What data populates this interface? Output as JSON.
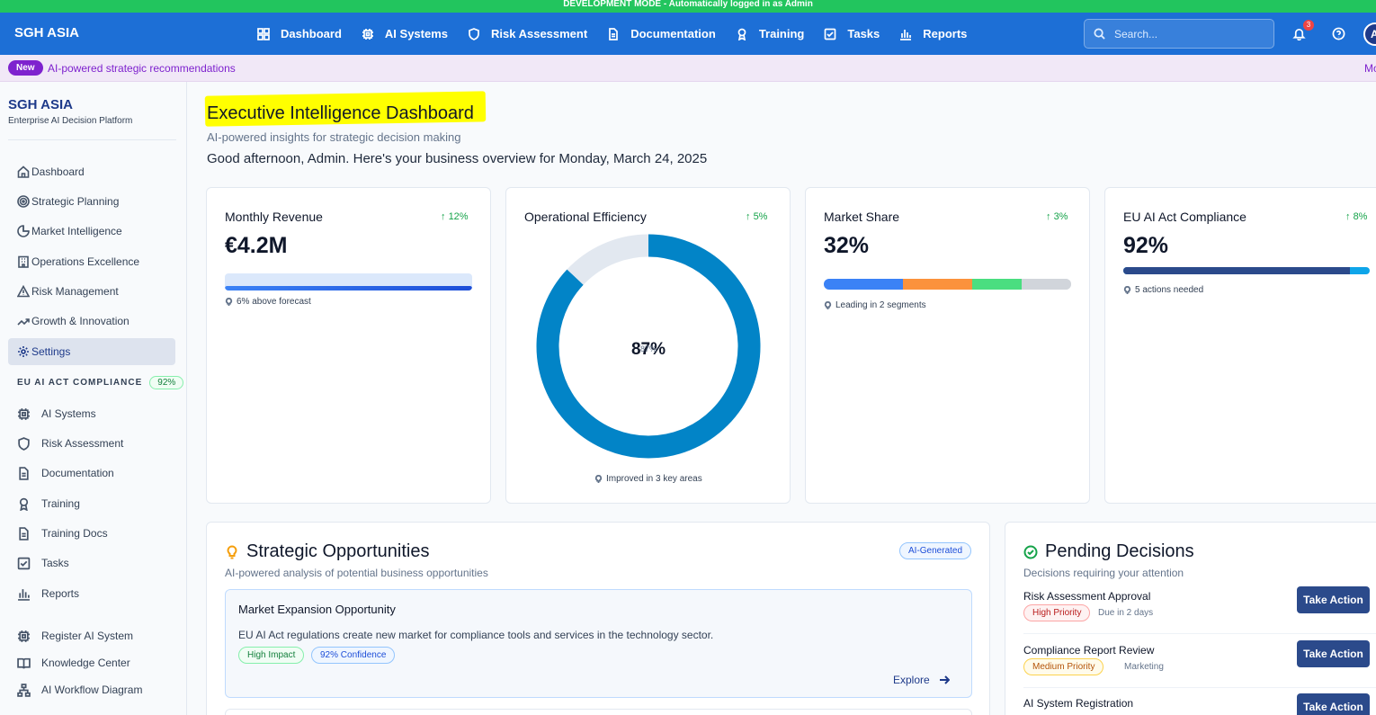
{
  "dev_banner": "DEVELOPMENT MODE - Automatically logged in as Admin",
  "topnav": {
    "brand": "SGH ASIA",
    "links": [
      {
        "label": "Dashboard",
        "icon": "grid-icon"
      },
      {
        "label": "AI Systems",
        "icon": "cpu-icon"
      },
      {
        "label": "Risk Assessment",
        "icon": "shield-icon"
      },
      {
        "label": "Documentation",
        "icon": "file-icon"
      },
      {
        "label": "Training",
        "icon": "award-icon"
      },
      {
        "label": "Tasks",
        "icon": "check-square-icon"
      },
      {
        "label": "Reports",
        "icon": "bar-chart-icon"
      }
    ],
    "search_placeholder": "Search...",
    "notification_count": "3",
    "avatar_initial": "A"
  },
  "promo": {
    "badge": "New",
    "text": "AI-powered strategic recommendations",
    "more": "Mo"
  },
  "sidebar": {
    "brand": "SGH ASIA",
    "subtitle": "Enterprise AI Decision Platform",
    "items": [
      {
        "label": "Dashboard",
        "icon": "home-icon"
      },
      {
        "label": "Strategic Planning",
        "icon": "target-icon"
      },
      {
        "label": "Market Intelligence",
        "icon": "pie-chart-icon"
      },
      {
        "label": "Operations Excellence",
        "icon": "building-icon"
      },
      {
        "label": "Risk Management",
        "icon": "alert-triangle-icon"
      },
      {
        "label": "Growth & Innovation",
        "icon": "trending-up-icon"
      },
      {
        "label": "Settings",
        "icon": "gear-icon",
        "active": true
      }
    ],
    "section_title": "EU AI ACT COMPLIANCE",
    "section_pct": "92%",
    "compliance_items": [
      {
        "label": "AI Systems",
        "icon": "cpu-icon"
      },
      {
        "label": "Risk Assessment",
        "icon": "shield-icon"
      },
      {
        "label": "Documentation",
        "icon": "file-icon"
      },
      {
        "label": "Training",
        "icon": "award-icon"
      },
      {
        "label": "Training Docs",
        "icon": "file-icon"
      },
      {
        "label": "Tasks",
        "icon": "check-square-icon"
      },
      {
        "label": "Reports",
        "icon": "bar-chart-icon"
      }
    ],
    "bottom_items": [
      {
        "label": "Register AI System",
        "icon": "cpu-icon"
      },
      {
        "label": "Knowledge Center",
        "icon": "book-icon"
      },
      {
        "label": "AI Workflow Diagram",
        "icon": "workflow-icon"
      }
    ]
  },
  "page": {
    "title": "Executive Intelligence Dashboard",
    "subtitle": "AI-powered insights for strategic decision making",
    "greeting": "Good afternoon, Admin. Here's your business overview for Monday, March 24, 2025"
  },
  "kpis": {
    "revenue": {
      "title": "Monthly Revenue",
      "trend": "12%",
      "value": "€4.2M",
      "progress": 1.0,
      "note": "6% above forecast"
    },
    "efficiency": {
      "title": "Operational Efficiency",
      "trend": "5%",
      "value": "87%",
      "overlap_text": "87%",
      "percent": 87,
      "note": "Improved in 3 key areas"
    },
    "market": {
      "title": "Market Share",
      "trend": "3%",
      "value": "32%",
      "segments": [
        {
          "share": 32,
          "color": "#3b82f6"
        },
        {
          "share": 28,
          "color": "#fb923c"
        },
        {
          "share": 20,
          "color": "#4ade80"
        },
        {
          "share": 20,
          "color": "#d1d5db"
        }
      ],
      "note": "Leading in 2 segments"
    },
    "compliance": {
      "title": "EU AI Act Compliance",
      "trend": "8%",
      "value": "92%",
      "percent": 92,
      "note": "5 actions needed"
    }
  },
  "opportunities": {
    "title": "Strategic Opportunities",
    "tag": "AI-Generated",
    "subtitle": "AI-powered analysis of potential business opportunities",
    "items": [
      {
        "title": "Market Expansion Opportunity",
        "description": "EU AI Act regulations create new market for compliance tools and services in the technology sector.",
        "impact": "High Impact",
        "confidence": "92% Confidence",
        "action": "Explore"
      }
    ]
  },
  "decisions": {
    "title": "Pending Decisions",
    "subtitle": "Decisions requiring your attention",
    "items": [
      {
        "title": "Risk Assessment Approval",
        "priority": "High Priority",
        "meta": "Due in 2 days",
        "action": "Take Action"
      },
      {
        "title": "Compliance Report Review",
        "priority": "Medium Priority",
        "meta": "Marketing",
        "action": "Take Action"
      },
      {
        "title": "AI System Registration",
        "priority": "",
        "meta": "",
        "action": "Take Action"
      }
    ]
  },
  "colors": {
    "brand_blue": "#1d6fd6",
    "navy": "#2b4a8b",
    "success": "#16a34a",
    "dev_green": "#22c55e",
    "purple": "#7e22ce",
    "highlight": "#ffff00"
  }
}
